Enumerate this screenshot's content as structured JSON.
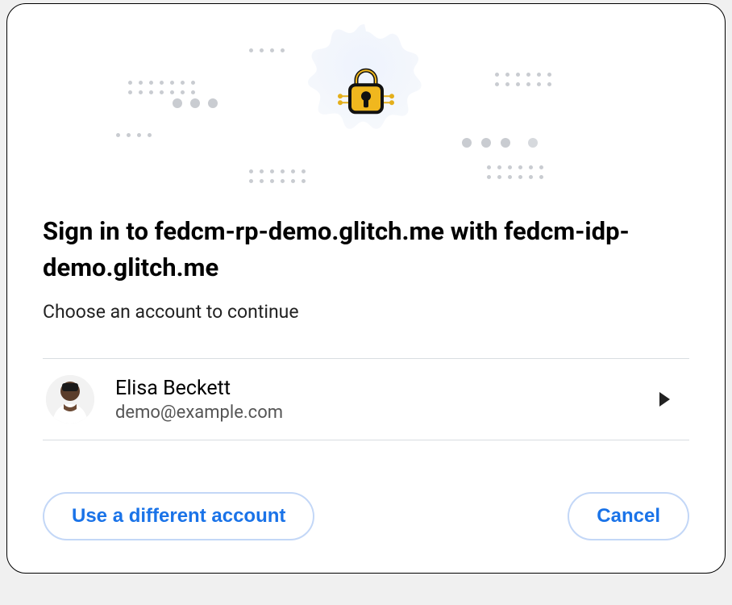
{
  "title": "Sign in to fedcm-rp-demo.glitch.me with fedcm-idp-demo.glitch.me",
  "subtitle": "Choose an account to continue",
  "account": {
    "name": "Elisa Beckett",
    "email": "demo@example.com"
  },
  "buttons": {
    "different": "Use a different account",
    "cancel": "Cancel"
  }
}
